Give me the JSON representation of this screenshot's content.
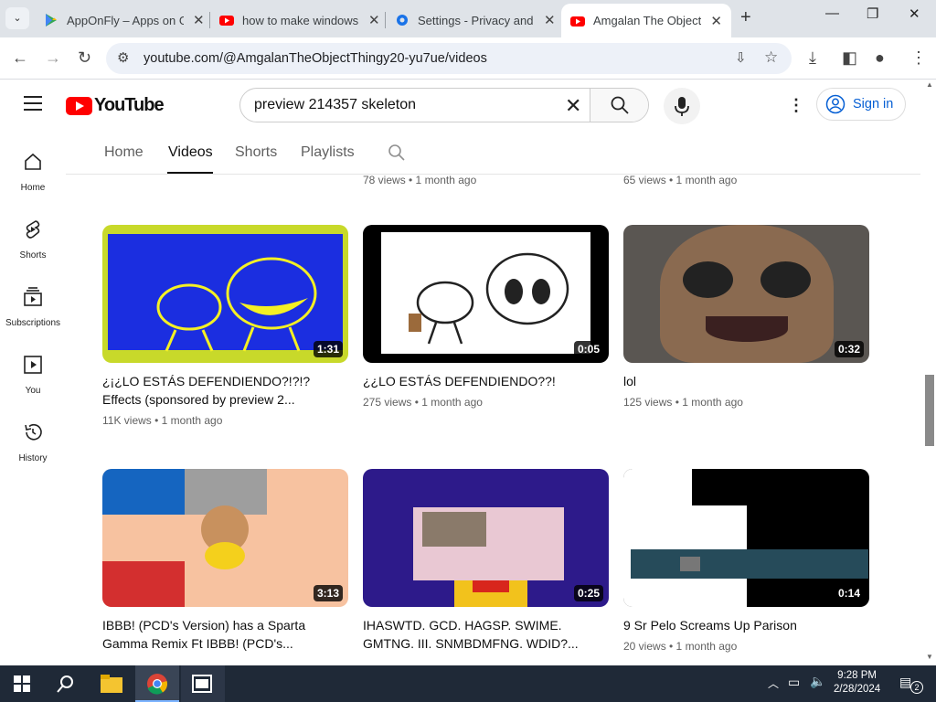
{
  "browser": {
    "tabs": [
      {
        "title": "AppOnFly – Apps on G",
        "favicon": "play-store-icon"
      },
      {
        "title": "how to make windows",
        "favicon": "youtube-icon"
      },
      {
        "title": "Settings - Privacy and",
        "favicon": "settings-gear-icon"
      },
      {
        "title": "Amgalan The Object T",
        "favicon": "youtube-icon",
        "active": true
      }
    ],
    "url": "youtube.com/@AmgalanTheObjectThingy20-yu7ue/videos"
  },
  "youtube": {
    "logo_text": "YouTube",
    "search_query": "preview 214357 skeleton",
    "signin_label": "Sign in",
    "nav": [
      {
        "label": "Home",
        "icon": "home-icon"
      },
      {
        "label": "Shorts",
        "icon": "shorts-icon"
      },
      {
        "label": "Subscriptions",
        "icon": "subscriptions-icon"
      },
      {
        "label": "You",
        "icon": "you-icon"
      },
      {
        "label": "History",
        "icon": "history-icon"
      }
    ],
    "channel_tabs": [
      "Home",
      "Videos",
      "Shorts",
      "Playlists"
    ],
    "active_tab": "Videos",
    "prev_row_meta": [
      "78 views • 1 month ago",
      "65 views • 1 month ago"
    ],
    "videos": [
      {
        "title": "¿¡¿LO ESTÁS DEFENDIENDO?!?!? Effects (sponsored by preview 2...",
        "meta": "11K views • 1 month ago",
        "duration": "1:31"
      },
      {
        "title": "¿¿LO ESTÁS DEFENDIENDO??!",
        "meta": "275 views • 1 month ago",
        "duration": "0:05"
      },
      {
        "title": "lol",
        "meta": "125 views • 1 month ago",
        "duration": "0:32"
      },
      {
        "title": "IBBB! (PCD's Version) has a Sparta Gamma Remix Ft IBBB! (PCD's...",
        "meta": "",
        "duration": "3:13"
      },
      {
        "title": "IHASWTD. GCD. HAGSP. SWIME. GMTNG. III. SNMBDMFNG. WDID?...",
        "meta": "",
        "duration": "0:25"
      },
      {
        "title": "9 Sr Pelo Screams Up Parison",
        "meta": "20 views • 1 month ago",
        "duration": "0:14"
      }
    ]
  },
  "taskbar": {
    "time": "9:28 PM",
    "date": "2/28/2024",
    "notif_count": "2"
  }
}
